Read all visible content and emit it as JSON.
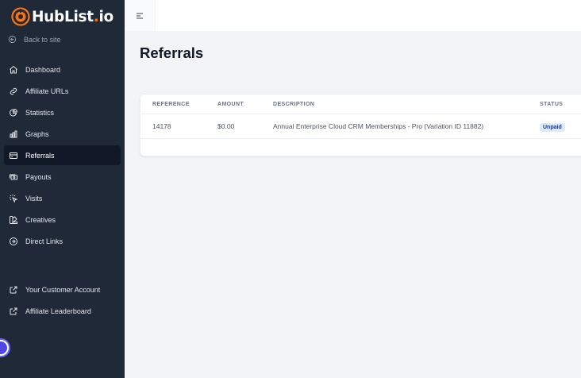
{
  "brand": {
    "name_part1": "HubList",
    "name_dot": ".",
    "name_part2": "io",
    "accent": "#f97316"
  },
  "sidebar": {
    "back_label": "Back to site",
    "items": [
      {
        "label": "Dashboard",
        "icon": "home-icon"
      },
      {
        "label": "Affiliate URLs",
        "icon": "link-icon"
      },
      {
        "label": "Statistics",
        "icon": "pie-chart-icon"
      },
      {
        "label": "Graphs",
        "icon": "bar-chart-icon"
      },
      {
        "label": "Referrals",
        "icon": "credit-card-icon",
        "active": true
      },
      {
        "label": "Payouts",
        "icon": "cash-icon"
      },
      {
        "label": "Visits",
        "icon": "cursor-click-icon"
      },
      {
        "label": "Creatives",
        "icon": "color-swatch-icon"
      },
      {
        "label": "Direct Links",
        "icon": "arrow-circle-right-icon"
      }
    ],
    "secondary_items": [
      {
        "label": "Your Customer Account",
        "icon": "external-link-icon"
      },
      {
        "label": "Affiliate Leaderboard",
        "icon": "external-link-icon"
      }
    ]
  },
  "page": {
    "title": "Referrals"
  },
  "table": {
    "headers": {
      "reference": "REFERENCE",
      "amount": "AMOUNT",
      "description": "DESCRIPTION",
      "status": "STATUS"
    },
    "rows": [
      {
        "reference": "14178",
        "amount": "$0.00",
        "description": "Annual Enterprise Cloud CRM Memberships - Pro (Variation ID 11882)",
        "status": "Unpaid"
      }
    ]
  }
}
